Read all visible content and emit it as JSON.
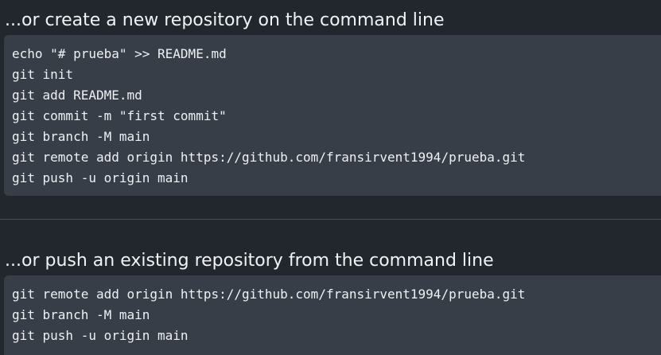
{
  "create_section": {
    "heading": "...or create a new repository on the command line",
    "lines": [
      "echo \"# prueba\" >> README.md",
      "git init",
      "git add README.md",
      "git commit -m \"first commit\"",
      "git branch -M main",
      "git remote add origin https://github.com/fransirvent1994/prueba.git",
      "git push -u origin main"
    ]
  },
  "push_section": {
    "heading": "...or push an existing repository from the command line",
    "lines": [
      "git remote add origin https://github.com/fransirvent1994/prueba.git",
      "git branch -M main",
      "git push -u origin main"
    ]
  },
  "colors": {
    "background": "#22272e",
    "code_background": "#373e47",
    "text": "#e6edf3"
  }
}
